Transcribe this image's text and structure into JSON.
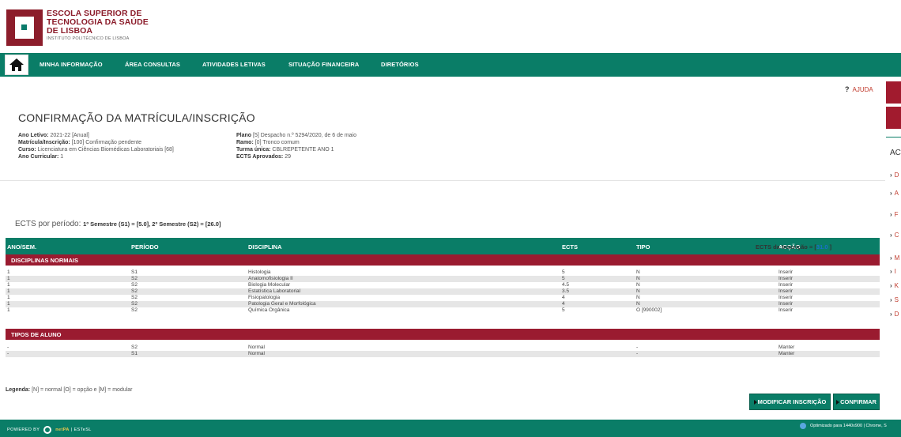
{
  "header": {
    "school_line1": "ESCOLA SUPERIOR DE",
    "school_line2": "TECNOLOGIA DA SAÚDE",
    "school_line3": "DE LISBOA",
    "school_sub": "INSTITUTO POLITÉCNICO DE LISBOA"
  },
  "nav": {
    "items": [
      "MINHA INFORMAÇÃO",
      "ÁREA CONSULTAS",
      "ATIVIDADES LETIVAS",
      "SITUAÇÃO FINANCEIRA",
      "DIRETÓRIOS"
    ]
  },
  "help": {
    "label": "AJUDA"
  },
  "side": {
    "title": "AC",
    "links": [
      "D",
      "A",
      "F",
      "C",
      "M",
      "I",
      "K",
      "S",
      "D"
    ]
  },
  "page_title": "CONFIRMAÇÃO DA MATRÍCULA/INSCRIÇÃO",
  "info": {
    "left": [
      {
        "label": "Ano Letivo:",
        "value": "2021-22 [Anual]"
      },
      {
        "label": "Matrícula/Inscrição:",
        "value": "[100] Confirmação pendente"
      },
      {
        "label": "Curso:",
        "value": "Licenciatura em Ciências Biomédicas Laboratoriais [68]"
      },
      {
        "label": "Ano Curricular:",
        "value": "1"
      }
    ],
    "right": [
      {
        "label": "Plano",
        "value": "[5] Despacho n.º 5294/2020, de 6 de maio"
      },
      {
        "label": "Ramo:",
        "value": "[0] Tronco comum"
      },
      {
        "label": "Turma única:",
        "value": "CBLREPETENTE ANO 1"
      },
      {
        "label": "ECTS Aprovados:",
        "value": "29"
      }
    ]
  },
  "ects_period": {
    "label": "ECTS por período:",
    "detail": "1º Semestre (S1) = [5.0], 2º Semestre (S2) = [26.0]"
  },
  "ects_inscricao": {
    "label": "ECTS da Inscrição = [",
    "value": "31.0",
    "close": "]"
  },
  "table": {
    "headers": [
      "ANO/SEM.",
      "PERÍODO",
      "DISCIPLINA",
      "ECTS",
      "TIPO",
      "ACÇÃO"
    ],
    "group1": "DISCIPLINAS NORMAIS",
    "rows1": [
      [
        "1",
        "S1",
        "Histologia",
        "5",
        "N",
        "Inserir"
      ],
      [
        "1",
        "S2",
        "Anatomofisiologia II",
        "5",
        "N",
        "Inserir"
      ],
      [
        "1",
        "S2",
        "Biologia Molecular",
        "4.5",
        "N",
        "Inserir"
      ],
      [
        "1",
        "S2",
        "Estatística Laboratorial",
        "3.5",
        "N",
        "Inserir"
      ],
      [
        "1",
        "S2",
        "Fisiopatologia",
        "4",
        "N",
        "Inserir"
      ],
      [
        "1",
        "S2",
        "Patologia Geral e Morfológica",
        "4",
        "N",
        "Inserir"
      ],
      [
        "1",
        "S2",
        "Química Orgânica",
        "5",
        "O [990002]",
        "Inserir"
      ]
    ],
    "group2": "TIPOS DE ALUNO",
    "rows2": [
      [
        "-",
        "S2",
        "Normal",
        "",
        "-",
        "Manter"
      ],
      [
        "-",
        "S1",
        "Normal",
        "",
        "-",
        "Manter"
      ]
    ]
  },
  "legend": {
    "label": "Legenda:",
    "text": "[N] = normal [O] = opção e [M] = modular"
  },
  "buttons": {
    "modify": "MODIFICAR INSCRIÇÃO",
    "confirm": "CONFIRMAR"
  },
  "footer": {
    "powered": "POWERED BY",
    "netpa": "netPA",
    "org": "| ESTeSL",
    "optimized": "Optimizado para 1440x900 | Chrome, S"
  }
}
